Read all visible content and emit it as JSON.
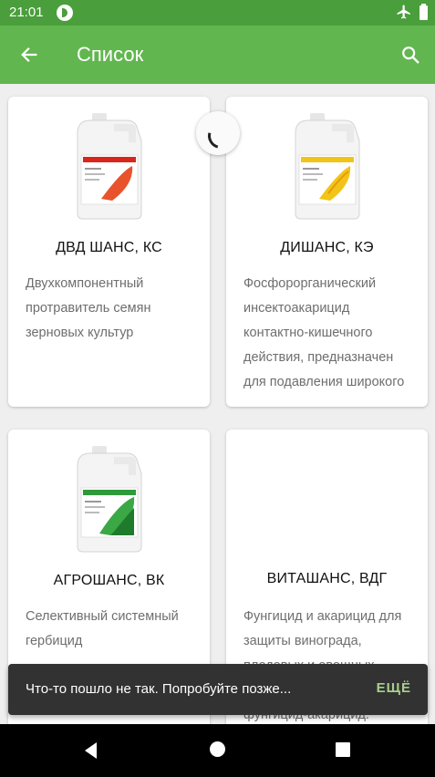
{
  "status_bar": {
    "time": "21:01"
  },
  "app_bar": {
    "title": "Список"
  },
  "products": [
    {
      "title": "ДВД ШАНС, КС",
      "description": "Двухкомпонентный протравитель семян зерновых культур",
      "label_color": "#e8532b",
      "image_icon": "canister-red-label"
    },
    {
      "title": "ДИШАНС, КЭ",
      "description": "Фосфорорганический инсектоакарицид контактно-кишечного действия, предназначен для подавления широкого спектра вредителей",
      "label_color": "#f2c418",
      "image_icon": "canister-yellow-label"
    },
    {
      "title": "АГРОШАНС, ВК",
      "description": "Селективный системный гербицид",
      "label_color": "#2f9a3a",
      "image_icon": "canister-green-label"
    },
    {
      "title": "ВИТАШАНС, ВДГ",
      "description": "Фунгицид и акарицид для защиты винограда, плодовых и овощных культур. Контактный фунгицид-акарицид.",
      "label_color": null,
      "image_icon": ""
    }
  ],
  "snackbar": {
    "message": "Что-то пошло не так. Попробуйте позже...",
    "action": "ЕЩЁ"
  },
  "colors": {
    "status_bar": "#4a9e3b",
    "app_bar": "#62b64f",
    "snackbar_action": "#a8d08d"
  }
}
